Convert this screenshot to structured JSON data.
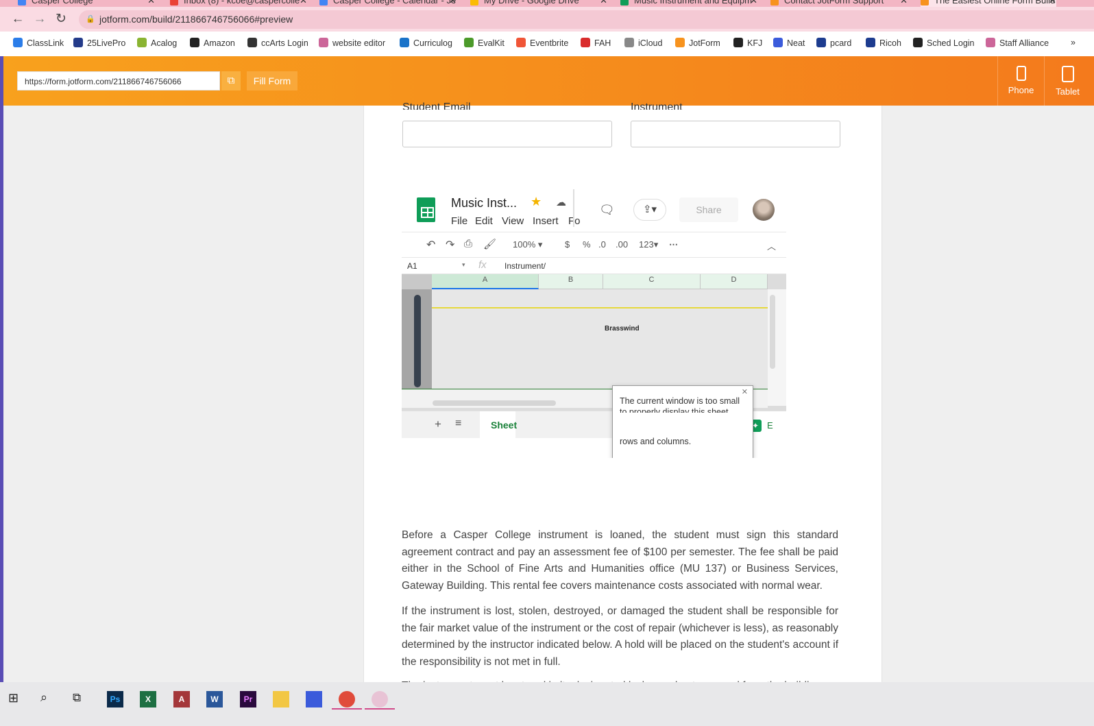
{
  "browser": {
    "tabs": [
      {
        "title": "Casper College",
        "color": "#4285f4"
      },
      {
        "title": "Inbox (8) - kcoe@caspercolle",
        "color": "#ea4335"
      },
      {
        "title": "Casper College - Calendar - Je",
        "color": "#4285f4"
      },
      {
        "title": "My Drive - Google Drive",
        "color": "#fbbc04"
      },
      {
        "title": "Music Instrument and Equipm",
        "color": "#0f9d58"
      },
      {
        "title": "Contact JotForm Support",
        "color": "#f7931e"
      },
      {
        "title": "The Easiest Online Form Build",
        "color": "#f7931e"
      }
    ],
    "url": "jotform.com/build/211866746756066#preview",
    "bookmarks": [
      {
        "label": "ClassLink",
        "color": "#2b7de9"
      },
      {
        "label": "25LivePro",
        "color": "#243b8a"
      },
      {
        "label": "Acalog",
        "color": "#8ab432"
      },
      {
        "label": "Amazon",
        "color": "#222222"
      },
      {
        "label": "ccArts Login",
        "color": "#333333"
      },
      {
        "label": "website editor",
        "color": "#cc6699"
      },
      {
        "label": "Curriculog",
        "color": "#1a73c9"
      },
      {
        "label": "EvalKit",
        "color": "#4c9a2a"
      },
      {
        "label": "Eventbrite",
        "color": "#f05537"
      },
      {
        "label": "FAH",
        "color": "#d92b2b"
      },
      {
        "label": "iCloud",
        "color": "#888888"
      },
      {
        "label": "JotForm",
        "color": "#f7931e"
      },
      {
        "label": "KFJ",
        "color": "#222222"
      },
      {
        "label": "Neat",
        "color": "#3b5bdb"
      },
      {
        "label": "pcard",
        "color": "#1d3c8f"
      },
      {
        "label": "Ricoh",
        "color": "#1d3c8f"
      },
      {
        "label": "Sched Login",
        "color": "#222222"
      },
      {
        "label": "Staff Alliance",
        "color": "#cc6699"
      }
    ],
    "more_bookmarks": "»"
  },
  "jotform": {
    "form_url": "https://form.jotform.com/211866746756066",
    "fill_form": "Fill Form",
    "phone": "Phone",
    "tablet": "Tablet"
  },
  "form": {
    "student_email_label": "Student Email",
    "instrument_label": "Instrument",
    "paragraphs": [
      "Before a Casper College instrument is loaned, the student must sign this standard agreement contract and pay an assessment fee of $100 per semester. The fee shall be paid either in the School of Fine Arts and Humanities office (MU 137) or Business Services, Gateway Building. This rental fee covers maintenance costs associated with normal wear.",
      "If the instrument is lost, stolen, destroyed, or damaged the student shall be responsible for the fair market value of the instrument or the cost of repair (whichever is less), as reasonably determined by the instructor indicated below. A hold will be placed on the student's account if the responsibility is not met in full.",
      "The instrument must be stored in its designated locker and not removed from the building."
    ]
  },
  "sheet": {
    "title": "Music Inst...",
    "menus": [
      "File",
      "Edit",
      "View",
      "Insert",
      "Fo"
    ],
    "share": "Share",
    "zoom": "100%",
    "currency": "$",
    "percent": "%",
    "dec_less": ".0",
    "dec_more": ".00",
    "format": "123",
    "cell_ref": "A1",
    "fx": "fx",
    "formula_value": "Instrument/",
    "columns": [
      "A",
      "B",
      "C",
      "D"
    ],
    "cell_text": "Brasswind",
    "sheet_tab": "Sheet",
    "explore": "E",
    "popup_line1": "The current window is too small",
    "popup_line2": "to properly display this sheet.",
    "popup_line3": "rows and columns."
  },
  "taskbar": {
    "apps": [
      {
        "name": "photoshop",
        "label": "Ps",
        "color": "#0b2a4a",
        "fg": "#31a8ff"
      },
      {
        "name": "excel",
        "label": "X",
        "color": "#1d6f42",
        "fg": "#ffffff"
      },
      {
        "name": "access",
        "label": "A",
        "color": "#a4373a",
        "fg": "#ffffff"
      },
      {
        "name": "word",
        "label": "W",
        "color": "#2b579a",
        "fg": "#ffffff"
      },
      {
        "name": "premiere",
        "label": "Pr",
        "color": "#2a0a3d",
        "fg": "#e77cff"
      },
      {
        "name": "file-explorer",
        "label": "",
        "color": "#f2c744",
        "fg": "#ffffff"
      },
      {
        "name": "neat",
        "label": "",
        "color": "#3b5bdb",
        "fg": "#ffffff"
      },
      {
        "name": "chrome",
        "label": "",
        "color": "#e04b3b",
        "fg": "#ffffff"
      },
      {
        "name": "chrome-profile",
        "label": "",
        "color": "#e8c3d5",
        "fg": "#ffffff"
      }
    ]
  }
}
